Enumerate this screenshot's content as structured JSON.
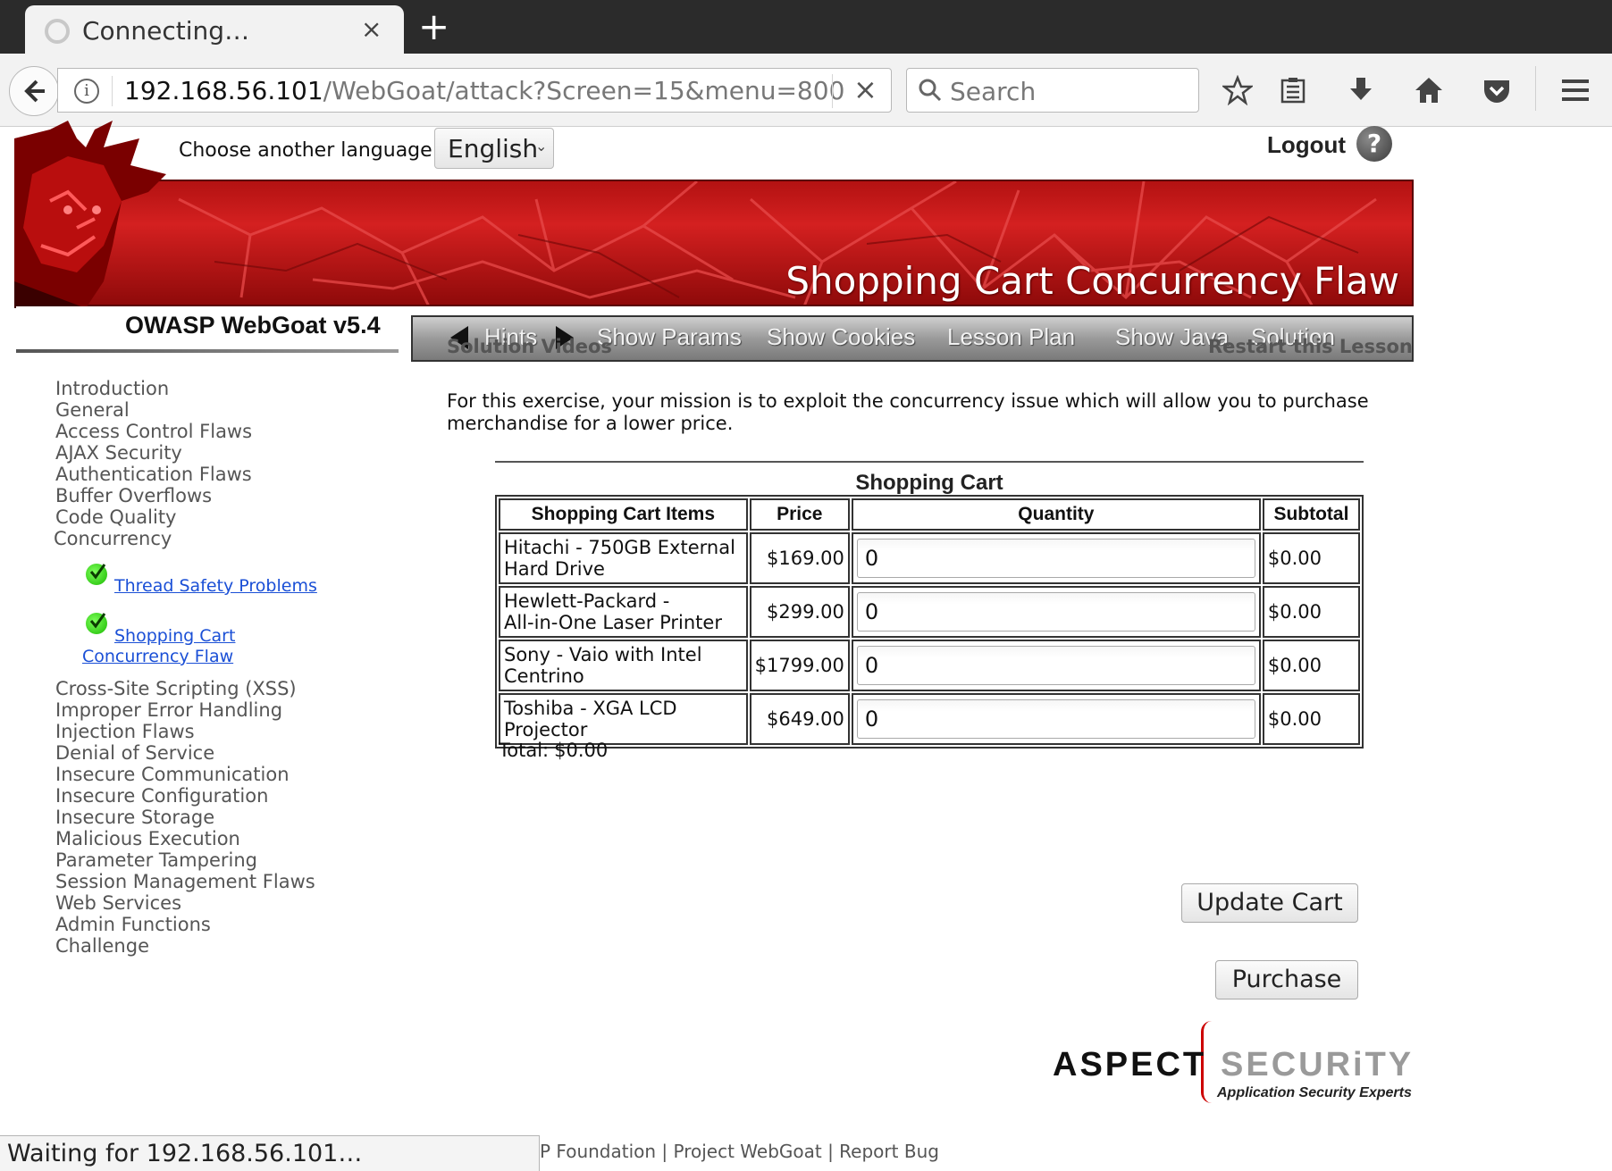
{
  "browser": {
    "tab_title": "Connecting…",
    "tab_close": "×",
    "new_tab": "+",
    "url_host": "192.168.56.101",
    "url_path": "/WebGoat/attack?Screen=15&menu=800",
    "url_clear": "×",
    "search_placeholder": "Search",
    "status_text": "Waiting for 192.168.56.101…"
  },
  "header": {
    "language_label": "Choose another language:",
    "language_value": "English",
    "logout": "Logout",
    "help": "?",
    "banner_title": "Shopping Cart Concurrency Flaw",
    "version": "OWASP WebGoat  v5.4"
  },
  "toolbar": {
    "hints": "Hints",
    "show_params": "Show Params",
    "show_cookies": "Show Cookies",
    "lesson_plan": "Lesson Plan",
    "show_java": "Show Java",
    "solution": "Solution"
  },
  "sidebar": {
    "items_top": [
      "Introduction",
      "General",
      "Access Control Flaws",
      "AJAX Security",
      "Authentication Flaws",
      "Buffer Overflows",
      "Code Quality",
      "Concurrency"
    ],
    "sub_items": [
      "Thread Safety Problems",
      "Shopping Cart",
      "Concurrency Flaw"
    ],
    "items_bottom": [
      "Cross-Site Scripting (XSS)",
      "Improper Error Handling",
      "Injection Flaws",
      "Denial of Service",
      "Insecure Communication",
      "Insecure Configuration",
      "Insecure Storage",
      "Malicious Execution",
      "Parameter Tampering",
      "Session Management Flaws",
      "Web Services",
      "Admin Functions",
      "Challenge"
    ]
  },
  "content": {
    "solution_videos": "Solution Videos",
    "restart": "Restart this Lesson",
    "mission": "For this exercise, your mission is to exploit the concurrency issue which will allow you to purchase merchandise for a lower price.",
    "cart_title": "Shopping Cart",
    "headers": [
      "Shopping Cart Items",
      "Price",
      "Quantity",
      "Subtotal"
    ],
    "rows": [
      {
        "item_line1": "Hitachi - 750GB External",
        "item_line2": "Hard Drive",
        "price": "$169.00",
        "qty": "0",
        "subtotal": "$0.00"
      },
      {
        "item_line1": "Hewlett-Packard -",
        "item_line2": "All-in-One Laser Printer",
        "price": "$299.00",
        "qty": "0",
        "subtotal": "$0.00"
      },
      {
        "item_line1": "Sony - Vaio with Intel",
        "item_line2": "Centrino",
        "price": "$1799.00",
        "qty": "0",
        "subtotal": "$0.00"
      },
      {
        "item_line1": "Toshiba - XGA LCD",
        "item_line2": "Projector",
        "price": "$649.00",
        "qty": "0",
        "subtotal": "$0.00"
      }
    ],
    "total_label": "Total:",
    "total_value": "$0.00",
    "update_cart": "Update Cart",
    "purchase": "Purchase"
  },
  "branding": {
    "aspect_word1": "ASPECT",
    "aspect_word2": "SECURiTY",
    "aspect_tagline": "Application Security Experts"
  },
  "footer": {
    "text": "P Foundation | Project WebGoat | Report Bug"
  },
  "colors": {
    "banner_red": "#c41a1a",
    "link_blue": "#1a4fd6",
    "menu_gray": "#555555"
  }
}
